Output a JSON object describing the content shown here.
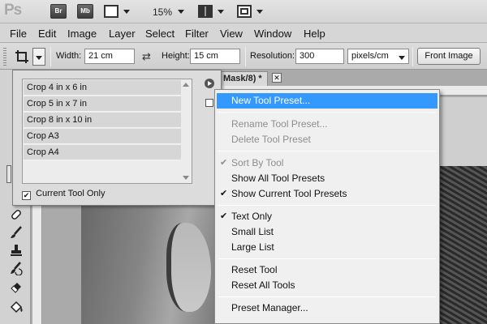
{
  "appbar": {
    "logo": "Ps",
    "bridge_label": "Br",
    "minibridge_label": "Mb",
    "zoom": "15%"
  },
  "menubar": {
    "items": [
      "File",
      "Edit",
      "Image",
      "Layer",
      "Select",
      "Filter",
      "View",
      "Window",
      "Help"
    ]
  },
  "options": {
    "width_label": "Width:",
    "width_value": "21 cm",
    "height_label": "Height:",
    "height_value": "15 cm",
    "resolution_label": "Resolution:",
    "resolution_value": "300",
    "resolution_unit": "pixels/cm",
    "front_image_label": "Front Image"
  },
  "document": {
    "tab_title": "Mask/8) *",
    "close_glyph": "✕"
  },
  "preset_panel": {
    "presets": [
      "Crop 4 in x 6 in",
      "Crop 5 in x 7 in",
      "Crop 8 in x 10 in",
      "Crop A3",
      "Crop A4"
    ],
    "current_tool_only_label": "Current Tool Only",
    "current_tool_only_checked": true
  },
  "context_menu": {
    "new_tool_preset": "New Tool Preset...",
    "rename_tool_preset": "Rename Tool Preset...",
    "delete_tool_preset": "Delete Tool Preset",
    "sort_by_tool": "Sort By Tool",
    "show_all_tool_presets": "Show All Tool Presets",
    "show_current_tool_presets": "Show Current Tool Presets",
    "text_only": "Text Only",
    "small_list": "Small List",
    "large_list": "Large List",
    "reset_tool": "Reset Tool",
    "reset_all_tools": "Reset All Tools",
    "preset_manager": "Preset Manager...",
    "check_glyph": "✔"
  },
  "colors": {
    "highlight": "#3399ff",
    "disabled_text": "#8d8d8d"
  }
}
